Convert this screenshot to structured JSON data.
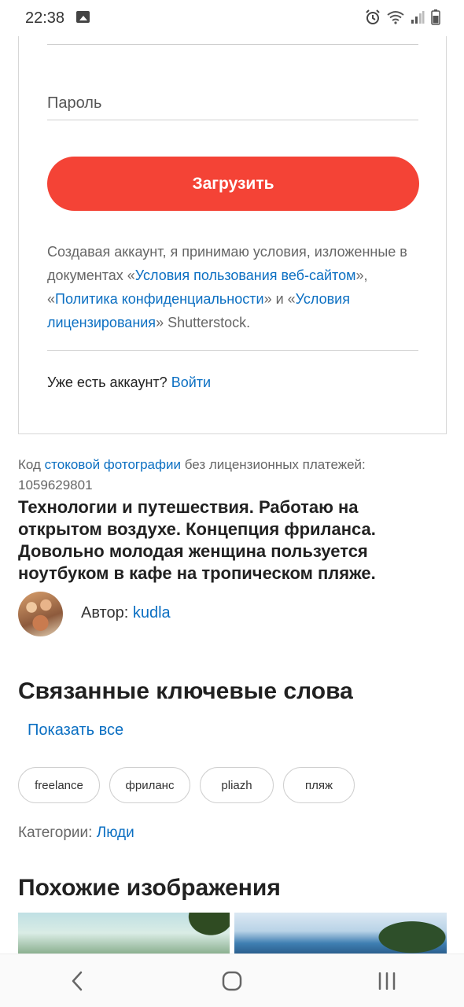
{
  "status_bar": {
    "time": "22:38",
    "icons": [
      "gallery-icon",
      "alarm-icon",
      "wifi-icon",
      "signal-icon",
      "battery-icon"
    ]
  },
  "login_form": {
    "password_label": "Пароль",
    "upload_button_label": "Загрузить",
    "terms": {
      "part1": "Создавая аккаунт, я принимаю условия, изложенные в документах «",
      "link_terms_of_use": "Условия пользования веб-сайтом",
      "part2": "», «",
      "link_privacy_policy": "Политика конфиденциальности",
      "part3": "» и «",
      "link_license_terms": "Условия лицензирования",
      "part4": "» Shutterstock."
    },
    "have_account_text": "Уже есть аккаунт?",
    "login_link": "Войти"
  },
  "photo": {
    "code_prefix": "Код",
    "code_link": "стоковой фотографии",
    "code_suffix": "без лицензионных платежей:",
    "code_number": "1059629801",
    "title": "Технологии и путешествия. Работаю на открытом воздухе. Концепция фриланса. Довольно молодая женщина пользуется ноутбуком в кафе на тропическом пляже.",
    "author_label": "Автор:",
    "author_name": "kudla"
  },
  "related_keywords": {
    "title": "Связанные ключевые слова",
    "show_all": "Показать все",
    "tags": [
      "freelance",
      "фриланс",
      "pliazh",
      "пляж"
    ]
  },
  "categories": {
    "label": "Категории:",
    "value": "Люди"
  },
  "similar_images": {
    "title": "Похожие изображения"
  },
  "nav_bar": {
    "icons": [
      "back-icon",
      "home-icon",
      "recent-apps-icon"
    ]
  },
  "colors": {
    "accent": "#f44336",
    "link": "#0b6fc2"
  }
}
